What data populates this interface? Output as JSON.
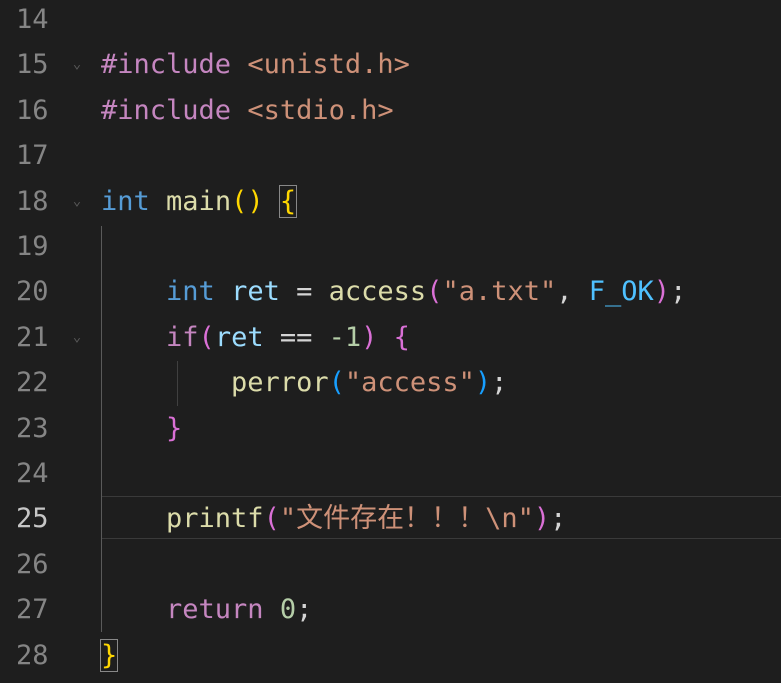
{
  "editor": {
    "theme": {
      "background": "#1e1e1e",
      "line_number": "#858585",
      "keyword_control": "#c586c0",
      "type": "#569cd6",
      "function": "#dcdcaa",
      "variable": "#9cdcfe",
      "constant": "#4fc1ff",
      "string": "#ce9178",
      "number": "#b5cea8",
      "plain": "#d4d4d4"
    },
    "current_line_number": "25",
    "lines": [
      {
        "num": "14",
        "fold": "",
        "tokens": []
      },
      {
        "num": "15",
        "fold": "chevron-down",
        "tokens": [
          {
            "t": "#include",
            "c": "t-keyword-ctrl"
          },
          {
            "t": " ",
            "c": "t-plain"
          },
          {
            "t": "<unistd.h>",
            "c": "t-string"
          }
        ]
      },
      {
        "num": "16",
        "fold": "",
        "tokens": [
          {
            "t": "#include",
            "c": "t-keyword-ctrl"
          },
          {
            "t": " ",
            "c": "t-plain"
          },
          {
            "t": "<stdio.h>",
            "c": "t-string"
          }
        ]
      },
      {
        "num": "17",
        "fold": "",
        "tokens": []
      },
      {
        "num": "18",
        "fold": "chevron-down",
        "tokens": [
          {
            "t": "int",
            "c": "t-type"
          },
          {
            "t": " ",
            "c": "t-plain"
          },
          {
            "t": "main",
            "c": "t-func"
          },
          {
            "t": "()",
            "c": "t-brace1"
          },
          {
            "t": " ",
            "c": "t-plain"
          },
          {
            "t": "{",
            "c": "t-brace1 bracket-box"
          }
        ]
      },
      {
        "num": "19",
        "fold": "",
        "tokens": []
      },
      {
        "num": "20",
        "fold": "",
        "tokens": [
          {
            "t": "    ",
            "c": "t-plain"
          },
          {
            "t": "int",
            "c": "t-type"
          },
          {
            "t": " ",
            "c": "t-plain"
          },
          {
            "t": "ret",
            "c": "t-var"
          },
          {
            "t": " = ",
            "c": "t-plain"
          },
          {
            "t": "access",
            "c": "t-func"
          },
          {
            "t": "(",
            "c": "t-brace2"
          },
          {
            "t": "\"a.txt\"",
            "c": "t-string"
          },
          {
            "t": ", ",
            "c": "t-plain"
          },
          {
            "t": "F_OK",
            "c": "t-const"
          },
          {
            "t": ")",
            "c": "t-brace2"
          },
          {
            "t": ";",
            "c": "t-plain"
          }
        ]
      },
      {
        "num": "21",
        "fold": "chevron-down",
        "tokens": [
          {
            "t": "    ",
            "c": "t-plain"
          },
          {
            "t": "if",
            "c": "t-keyword-ctrl"
          },
          {
            "t": "(",
            "c": "t-brace2"
          },
          {
            "t": "ret",
            "c": "t-var"
          },
          {
            "t": " == ",
            "c": "t-plain"
          },
          {
            "t": "-1",
            "c": "t-number"
          },
          {
            "t": ")",
            "c": "t-brace2"
          },
          {
            "t": " ",
            "c": "t-plain"
          },
          {
            "t": "{",
            "c": "t-brace2"
          }
        ]
      },
      {
        "num": "22",
        "fold": "",
        "tokens": [
          {
            "t": "        ",
            "c": "t-plain"
          },
          {
            "t": "perror",
            "c": "t-func"
          },
          {
            "t": "(",
            "c": "t-brace3"
          },
          {
            "t": "\"access\"",
            "c": "t-string"
          },
          {
            "t": ")",
            "c": "t-brace3"
          },
          {
            "t": ";",
            "c": "t-plain"
          }
        ]
      },
      {
        "num": "23",
        "fold": "",
        "tokens": [
          {
            "t": "    ",
            "c": "t-plain"
          },
          {
            "t": "}",
            "c": "t-brace2"
          }
        ]
      },
      {
        "num": "24",
        "fold": "",
        "tokens": []
      },
      {
        "num": "25",
        "fold": "",
        "tokens": [
          {
            "t": "    ",
            "c": "t-plain"
          },
          {
            "t": "printf",
            "c": "t-func"
          },
          {
            "t": "(",
            "c": "t-brace2"
          },
          {
            "t": "\"文件存在！！！\\n\"",
            "c": "t-string"
          },
          {
            "t": ")",
            "c": "t-brace2"
          },
          {
            "t": ";",
            "c": "t-plain"
          }
        ]
      },
      {
        "num": "26",
        "fold": "",
        "tokens": []
      },
      {
        "num": "27",
        "fold": "",
        "tokens": [
          {
            "t": "    ",
            "c": "t-plain"
          },
          {
            "t": "return",
            "c": "t-keyword-ctrl"
          },
          {
            "t": " ",
            "c": "t-plain"
          },
          {
            "t": "0",
            "c": "t-number"
          },
          {
            "t": ";",
            "c": "t-plain"
          }
        ]
      },
      {
        "num": "28",
        "fold": "",
        "tokens": [
          {
            "t": "}",
            "c": "t-brace1 bracket-box"
          }
        ]
      }
    ]
  }
}
